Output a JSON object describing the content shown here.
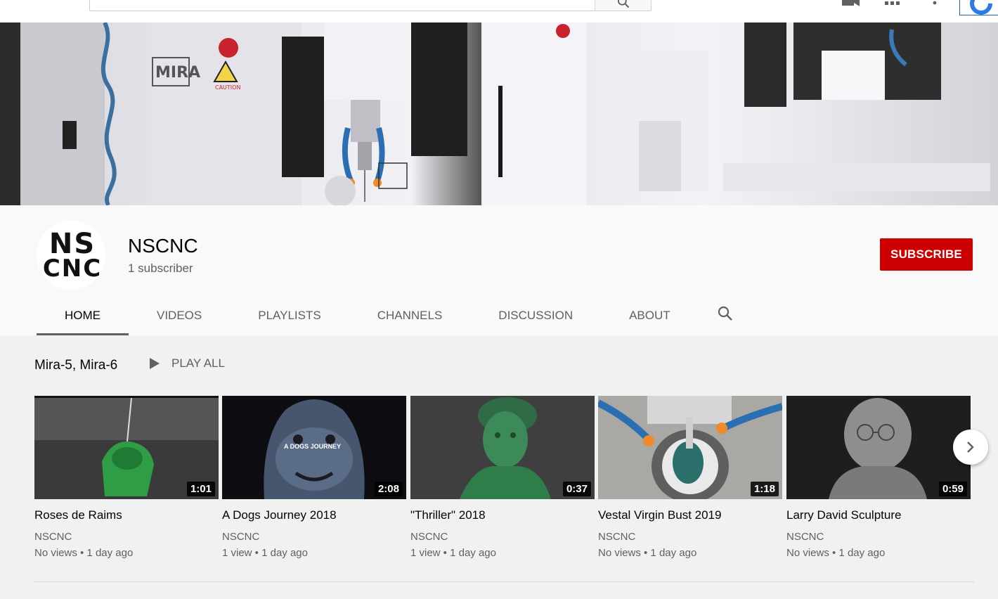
{
  "topbar": {
    "search_placeholder": "Search",
    "icons": [
      "search-icon",
      "video-camera-icon",
      "apps-grid-icon",
      "more-vert-icon",
      "account-avatar"
    ]
  },
  "channel": {
    "logo_line1": "NS",
    "logo_line2": "CNC",
    "name": "NSCNC",
    "subscribers": "1 subscriber",
    "subscribe_label": "SUBSCRIBE",
    "accent_color": "#cc0000"
  },
  "tabs": [
    {
      "label": "HOME",
      "active": true
    },
    {
      "label": "VIDEOS"
    },
    {
      "label": "PLAYLISTS"
    },
    {
      "label": "CHANNELS"
    },
    {
      "label": "DISCUSSION"
    },
    {
      "label": "ABOUT"
    }
  ],
  "shelf": {
    "title": "Mira-5, Mira-6",
    "play_all_label": "PLAY ALL",
    "videos": [
      {
        "title": "Roses de Raims",
        "channel": "NSCNC",
        "meta": "No views • 1 day ago",
        "duration": "1:01"
      },
      {
        "title": "A Dogs Journey 2018",
        "channel": "NSCNC",
        "meta": "1 view • 1 day ago",
        "duration": "2:08",
        "overlay_text": "A DOGS JOURNEY"
      },
      {
        "title": "\"Thriller\" 2018",
        "channel": "NSCNC",
        "meta": "1 view • 1 day ago",
        "duration": "0:37"
      },
      {
        "title": "Vestal Virgin Bust 2019",
        "channel": "NSCNC",
        "meta": "No views • 1 day ago",
        "duration": "1:18"
      },
      {
        "title": "Larry David Sculpture",
        "channel": "NSCNC",
        "meta": "No views • 1 day ago",
        "duration": "0:59"
      }
    ]
  }
}
